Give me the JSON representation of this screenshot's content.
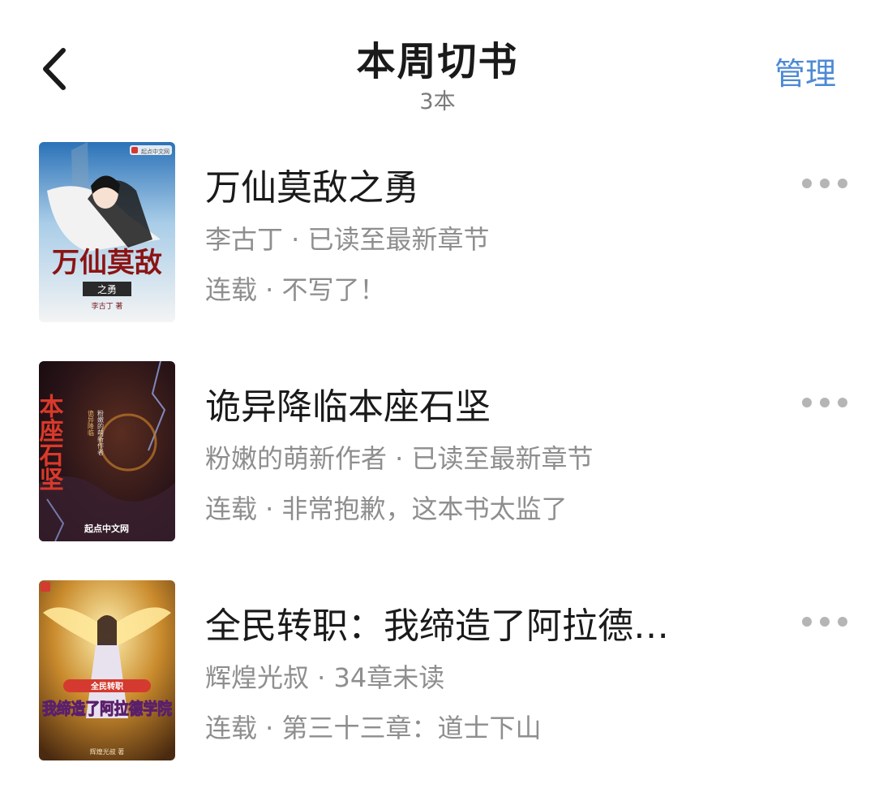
{
  "header": {
    "title": "本周切书",
    "count": "3本",
    "manage_label": "管理"
  },
  "books": [
    {
      "title": "万仙莫敌之勇",
      "meta": "李古丁 · 已读至最新章节",
      "status": "连载 · 不写了！",
      "cover": {
        "title_text": "万仙莫敌",
        "subtitle_text": "之勇",
        "author_text": "李古丁 著",
        "publisher_text": "起点中文网"
      }
    },
    {
      "title": "诡异降临本座石坚",
      "meta": "粉嫩的萌新作者 · 已读至最新章节",
      "status": "连载 · 非常抱歉，这本书太监了",
      "cover": {
        "title_text": "本座石坚",
        "subtitle_text": "诡异降临",
        "author_text": "粉嫩的萌新作者",
        "publisher_text": "起点中文网"
      }
    },
    {
      "title": "全民转职：我缔造了阿拉德…",
      "meta": "辉煌光叔 · 34章未读",
      "status": "连载 · 第三十三章：道士下山",
      "cover": {
        "title_text": "我缔造了阿拉德学院",
        "subtitle_text": "全民转职",
        "author_text": "辉煌光叔 著"
      }
    }
  ],
  "colors": {
    "accent": "#4d8ad6",
    "title_text": "#1a1a1a",
    "secondary_text": "#8e8e8e",
    "more_dots": "#b5b5b5"
  },
  "icons": {
    "back": "chevron-left-icon",
    "more": "more-horizontal-icon"
  }
}
